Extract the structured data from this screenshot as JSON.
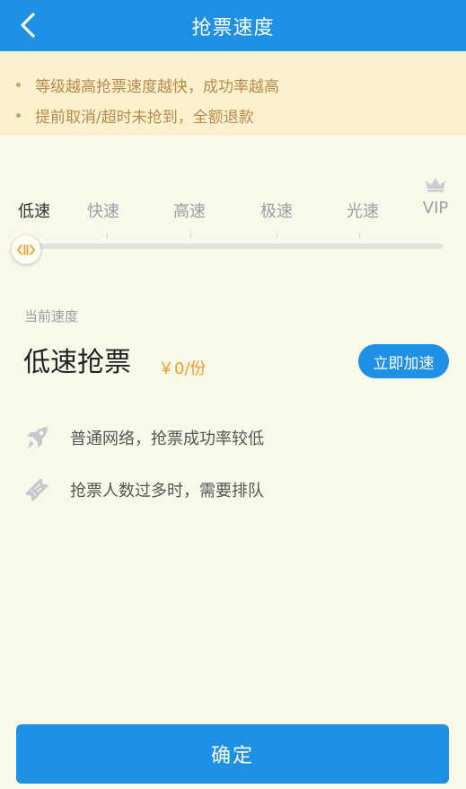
{
  "header": {
    "title": "抢票速度",
    "back_icon": "chevron-left-icon"
  },
  "notice": {
    "items": [
      "等级越高抢票速度越快，成功率越高",
      "提前取消/超时未抢到，全额退款"
    ]
  },
  "speed_levels": {
    "labels": [
      "低速",
      "快速",
      "高速",
      "极速",
      "光速",
      "VIP"
    ],
    "selected_index": 0,
    "vip_icon": "crown-icon"
  },
  "current": {
    "label": "当前速度",
    "name": "低速抢票",
    "price": "￥0/份",
    "boost_label": "立即加速"
  },
  "features": [
    {
      "icon": "rocket-icon",
      "text": "普通网络，抢票成功率较低"
    },
    {
      "icon": "ticket-icon",
      "text": "抢票人数过多时，需要排队"
    }
  ],
  "confirm_label": "确定",
  "colors": {
    "primary": "#1e90e6",
    "accent": "#f39a27",
    "notice_bg": "#fbf1cf",
    "page_bg": "#f8f9e8"
  }
}
